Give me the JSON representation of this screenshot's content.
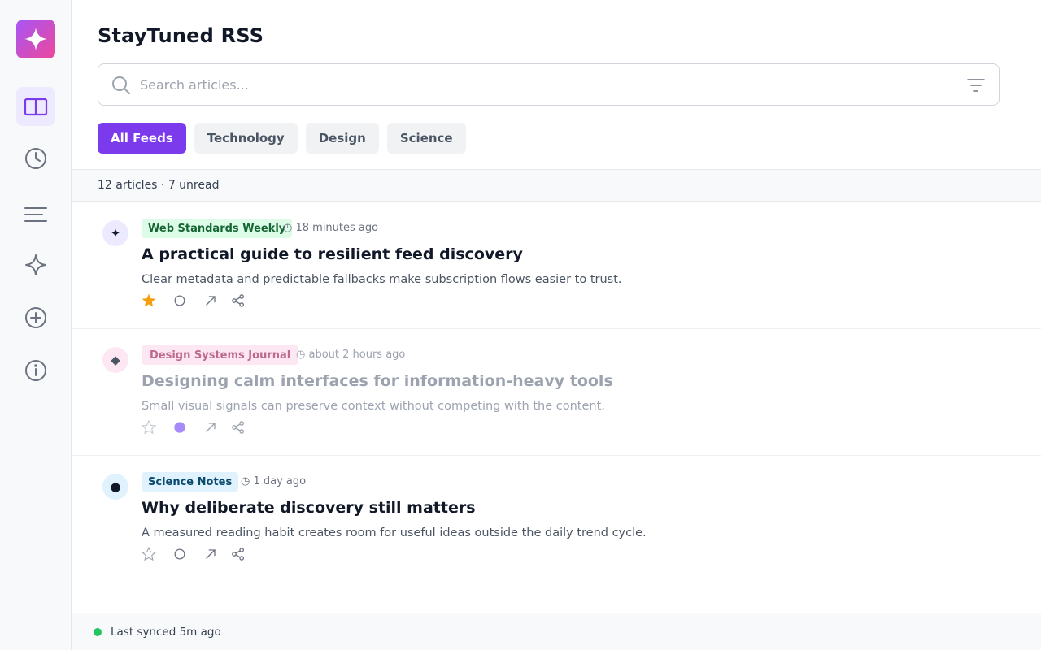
{
  "app": {
    "title": "StayTuned RSS"
  },
  "sidebar": {
    "items": [
      {
        "name": "reader",
        "icon": "book-open-icon",
        "active": true
      },
      {
        "name": "recent",
        "icon": "clock-icon",
        "active": false
      },
      {
        "name": "list",
        "icon": "menu-lines-icon",
        "active": false
      },
      {
        "name": "discover",
        "icon": "sparkle-icon",
        "active": false
      },
      {
        "name": "add",
        "icon": "plus-circle-icon",
        "active": false
      },
      {
        "name": "about",
        "icon": "info-icon",
        "active": false
      }
    ]
  },
  "search": {
    "placeholder": "Search articles...",
    "value": ""
  },
  "filters": [
    {
      "label": "All Feeds",
      "active": true
    },
    {
      "label": "Technology",
      "active": false
    },
    {
      "label": "Design",
      "active": false
    },
    {
      "label": "Science",
      "active": false
    }
  ],
  "summary": "12 articles · 7 unread",
  "articles": [
    {
      "icon": "✦",
      "feed": "Web Standards Weekly",
      "time": "◷ 18 minutes ago",
      "title": "A practical guide to resilient feed discovery",
      "summary": "Clear metadata and predictable fallbacks make subscription flows easier to trust.",
      "starred": true,
      "read": false
    },
    {
      "icon": "◆",
      "feed": "Design Systems Journal",
      "time": "◷ about 2 hours ago",
      "title": "Designing calm interfaces for information-heavy tools",
      "summary": "Small visual signals can preserve context without competing with the content.",
      "starred": false,
      "read": true
    },
    {
      "icon": "●",
      "feed": "Science Notes",
      "time": "◷ 1 day ago",
      "title": "Why deliberate discovery still matters",
      "summary": "A measured reading habit creates room for useful ideas outside the daily trend cycle.",
      "starred": false,
      "read": false
    }
  ],
  "status": {
    "text": "Last synced 5m ago",
    "color": "#22c55e"
  },
  "colors": {
    "accent": "#7c3aed",
    "star": "#f59e0b",
    "read_dot": "#a78bfa"
  }
}
